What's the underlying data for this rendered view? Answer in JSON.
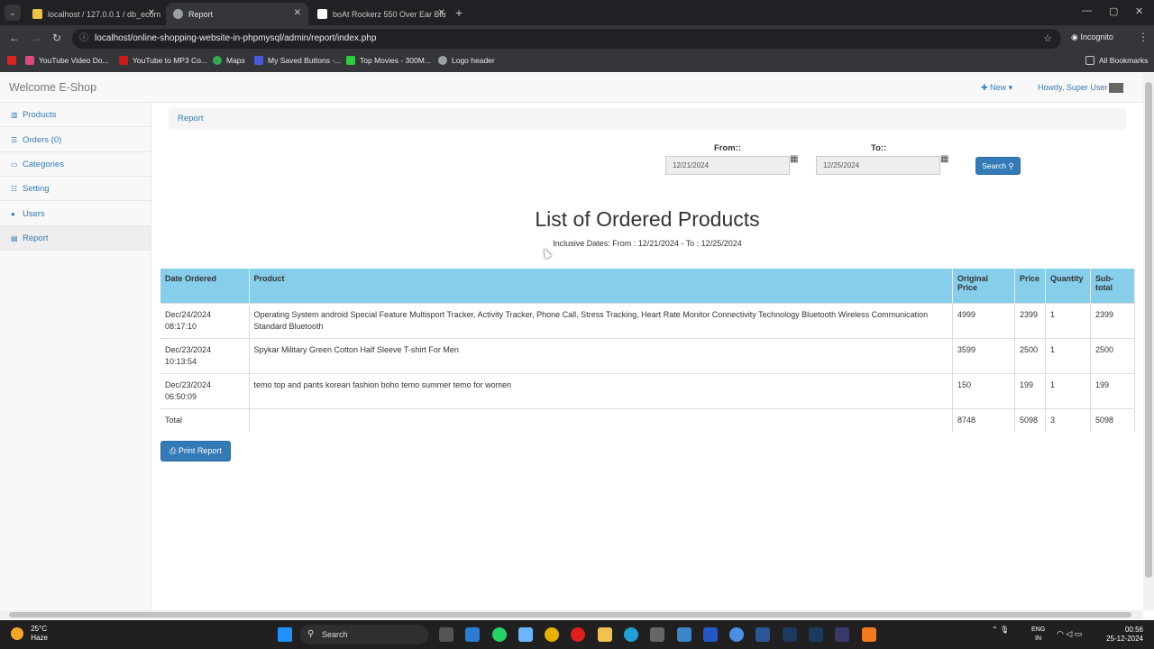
{
  "browser": {
    "tabs": [
      {
        "title": "localhost / 127.0.0.1 / db_ecom",
        "active": false
      },
      {
        "title": "Report",
        "active": true
      },
      {
        "title": "boAt Rockerz 550 Over Ear Blu",
        "active": false
      }
    ],
    "url": "localhost/online-shopping-website-in-phpmysql/admin/report/index.php",
    "incognito_label": "Incognito",
    "bookmarks": [
      "YouTube Video Do...",
      "YouTube to MP3 Co...",
      "Maps",
      "My Saved Buttons -...",
      "Top Movies - 300M...",
      "Logo header"
    ],
    "all_bookmarks_label": "All Bookmarks"
  },
  "topnav": {
    "brand": "Welcome E-Shop",
    "new_label": "New",
    "howdy": "Howdy, Super User"
  },
  "sidebar": {
    "items": [
      {
        "label": "Products",
        "icon": "list-icon"
      },
      {
        "label": "Orders (0)",
        "icon": "bars-icon"
      },
      {
        "label": "Categories",
        "icon": "tablet-icon"
      },
      {
        "label": "Setting",
        "icon": "sliders-icon"
      },
      {
        "label": "Users",
        "icon": "user-icon"
      },
      {
        "label": "Report",
        "icon": "file-icon"
      }
    ],
    "active": "Report"
  },
  "breadcrumb": "Report",
  "filter": {
    "from_label": "From::",
    "from_value": "12/21/2024",
    "to_label": "To::",
    "to_value": "12/25/2024",
    "search_label": "Search"
  },
  "report": {
    "title": "List of Ordered Products",
    "subtitle": "Inclusive Dates: From : 12/21/2024 - To : 12/25/2024",
    "columns": [
      "Date Ordered",
      "Product",
      "Original Price",
      "Price",
      "Quantity",
      "Sub-total"
    ],
    "rows": [
      {
        "date": "Dec/24/2024",
        "time": "08:17:10",
        "product": "Operating System android Special Feature Multisport Tracker, Activity Tracker, Phone Call, Stress Tracking, Heart Rate Monitor Connectivity Technology Bluetooth Wireless Communication Standard Bluetooth",
        "original_price": "4999",
        "price": "2399",
        "quantity": "1",
        "subtotal": "2399"
      },
      {
        "date": "Dec/23/2024",
        "time": "10:13:54",
        "product": "Spykar Military Green Cotton Half Sleeve T-shirt For Men",
        "original_price": "3599",
        "price": "2500",
        "quantity": "1",
        "subtotal": "2500"
      },
      {
        "date": "Dec/23/2024",
        "time": "06:50:09",
        "product": "temo top and pants korean fashion boho temo summer temo for women",
        "original_price": "150",
        "price": "199",
        "quantity": "1",
        "subtotal": "199"
      }
    ],
    "total": {
      "label": "Total",
      "original_price": "8748",
      "price": "5098",
      "quantity": "3",
      "subtotal": "5098"
    }
  },
  "print_label": "Print Report",
  "taskbar": {
    "temperature": "25°C",
    "weather": "Haze",
    "search_placeholder": "Search",
    "lang_top": "ENG",
    "lang_bottom": "IN",
    "time": "00:56",
    "date": "25-12-2024"
  },
  "colors": {
    "accent": "#337ab7",
    "table_header": "#87ceeb"
  }
}
